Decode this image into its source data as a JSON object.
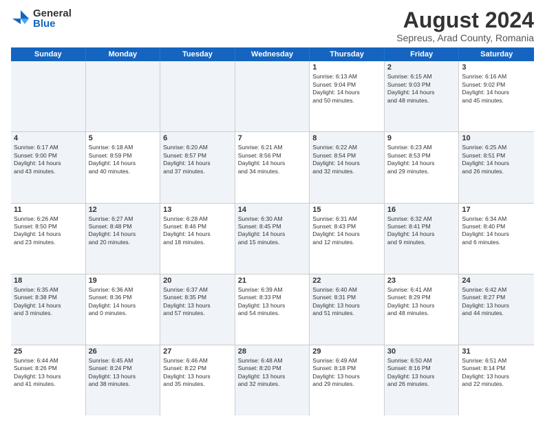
{
  "logo": {
    "general": "General",
    "blue": "Blue"
  },
  "title": "August 2024",
  "subtitle": "Sepreus, Arad County, Romania",
  "header_days": [
    "Sunday",
    "Monday",
    "Tuesday",
    "Wednesday",
    "Thursday",
    "Friday",
    "Saturday"
  ],
  "weeks": [
    [
      {
        "day": "",
        "text": "",
        "shaded": true
      },
      {
        "day": "",
        "text": "",
        "shaded": true
      },
      {
        "day": "",
        "text": "",
        "shaded": true
      },
      {
        "day": "",
        "text": "",
        "shaded": true
      },
      {
        "day": "1",
        "text": "Sunrise: 6:13 AM\nSunset: 9:04 PM\nDaylight: 14 hours\nand 50 minutes.",
        "shaded": false
      },
      {
        "day": "2",
        "text": "Sunrise: 6:15 AM\nSunset: 9:03 PM\nDaylight: 14 hours\nand 48 minutes.",
        "shaded": true
      },
      {
        "day": "3",
        "text": "Sunrise: 6:16 AM\nSunset: 9:02 PM\nDaylight: 14 hours\nand 45 minutes.",
        "shaded": false
      }
    ],
    [
      {
        "day": "4",
        "text": "Sunrise: 6:17 AM\nSunset: 9:00 PM\nDaylight: 14 hours\nand 43 minutes.",
        "shaded": true
      },
      {
        "day": "5",
        "text": "Sunrise: 6:18 AM\nSunset: 8:59 PM\nDaylight: 14 hours\nand 40 minutes.",
        "shaded": false
      },
      {
        "day": "6",
        "text": "Sunrise: 6:20 AM\nSunset: 8:57 PM\nDaylight: 14 hours\nand 37 minutes.",
        "shaded": true
      },
      {
        "day": "7",
        "text": "Sunrise: 6:21 AM\nSunset: 8:56 PM\nDaylight: 14 hours\nand 34 minutes.",
        "shaded": false
      },
      {
        "day": "8",
        "text": "Sunrise: 6:22 AM\nSunset: 8:54 PM\nDaylight: 14 hours\nand 32 minutes.",
        "shaded": true
      },
      {
        "day": "9",
        "text": "Sunrise: 6:23 AM\nSunset: 8:53 PM\nDaylight: 14 hours\nand 29 minutes.",
        "shaded": false
      },
      {
        "day": "10",
        "text": "Sunrise: 6:25 AM\nSunset: 8:51 PM\nDaylight: 14 hours\nand 26 minutes.",
        "shaded": true
      }
    ],
    [
      {
        "day": "11",
        "text": "Sunrise: 6:26 AM\nSunset: 8:50 PM\nDaylight: 14 hours\nand 23 minutes.",
        "shaded": false
      },
      {
        "day": "12",
        "text": "Sunrise: 6:27 AM\nSunset: 8:48 PM\nDaylight: 14 hours\nand 20 minutes.",
        "shaded": true
      },
      {
        "day": "13",
        "text": "Sunrise: 6:28 AM\nSunset: 8:46 PM\nDaylight: 14 hours\nand 18 minutes.",
        "shaded": false
      },
      {
        "day": "14",
        "text": "Sunrise: 6:30 AM\nSunset: 8:45 PM\nDaylight: 14 hours\nand 15 minutes.",
        "shaded": true
      },
      {
        "day": "15",
        "text": "Sunrise: 6:31 AM\nSunset: 8:43 PM\nDaylight: 14 hours\nand 12 minutes.",
        "shaded": false
      },
      {
        "day": "16",
        "text": "Sunrise: 6:32 AM\nSunset: 8:41 PM\nDaylight: 14 hours\nand 9 minutes.",
        "shaded": true
      },
      {
        "day": "17",
        "text": "Sunrise: 6:34 AM\nSunset: 8:40 PM\nDaylight: 14 hours\nand 6 minutes.",
        "shaded": false
      }
    ],
    [
      {
        "day": "18",
        "text": "Sunrise: 6:35 AM\nSunset: 8:38 PM\nDaylight: 14 hours\nand 3 minutes.",
        "shaded": true
      },
      {
        "day": "19",
        "text": "Sunrise: 6:36 AM\nSunset: 8:36 PM\nDaylight: 14 hours\nand 0 minutes.",
        "shaded": false
      },
      {
        "day": "20",
        "text": "Sunrise: 6:37 AM\nSunset: 8:35 PM\nDaylight: 13 hours\nand 57 minutes.",
        "shaded": true
      },
      {
        "day": "21",
        "text": "Sunrise: 6:39 AM\nSunset: 8:33 PM\nDaylight: 13 hours\nand 54 minutes.",
        "shaded": false
      },
      {
        "day": "22",
        "text": "Sunrise: 6:40 AM\nSunset: 8:31 PM\nDaylight: 13 hours\nand 51 minutes.",
        "shaded": true
      },
      {
        "day": "23",
        "text": "Sunrise: 6:41 AM\nSunset: 8:29 PM\nDaylight: 13 hours\nand 48 minutes.",
        "shaded": false
      },
      {
        "day": "24",
        "text": "Sunrise: 6:42 AM\nSunset: 8:27 PM\nDaylight: 13 hours\nand 44 minutes.",
        "shaded": true
      }
    ],
    [
      {
        "day": "25",
        "text": "Sunrise: 6:44 AM\nSunset: 8:26 PM\nDaylight: 13 hours\nand 41 minutes.",
        "shaded": false
      },
      {
        "day": "26",
        "text": "Sunrise: 6:45 AM\nSunset: 8:24 PM\nDaylight: 13 hours\nand 38 minutes.",
        "shaded": true
      },
      {
        "day": "27",
        "text": "Sunrise: 6:46 AM\nSunset: 8:22 PM\nDaylight: 13 hours\nand 35 minutes.",
        "shaded": false
      },
      {
        "day": "28",
        "text": "Sunrise: 6:48 AM\nSunset: 8:20 PM\nDaylight: 13 hours\nand 32 minutes.",
        "shaded": true
      },
      {
        "day": "29",
        "text": "Sunrise: 6:49 AM\nSunset: 8:18 PM\nDaylight: 13 hours\nand 29 minutes.",
        "shaded": false
      },
      {
        "day": "30",
        "text": "Sunrise: 6:50 AM\nSunset: 8:16 PM\nDaylight: 13 hours\nand 26 minutes.",
        "shaded": true
      },
      {
        "day": "31",
        "text": "Sunrise: 6:51 AM\nSunset: 8:14 PM\nDaylight: 13 hours\nand 22 minutes.",
        "shaded": false
      }
    ]
  ]
}
